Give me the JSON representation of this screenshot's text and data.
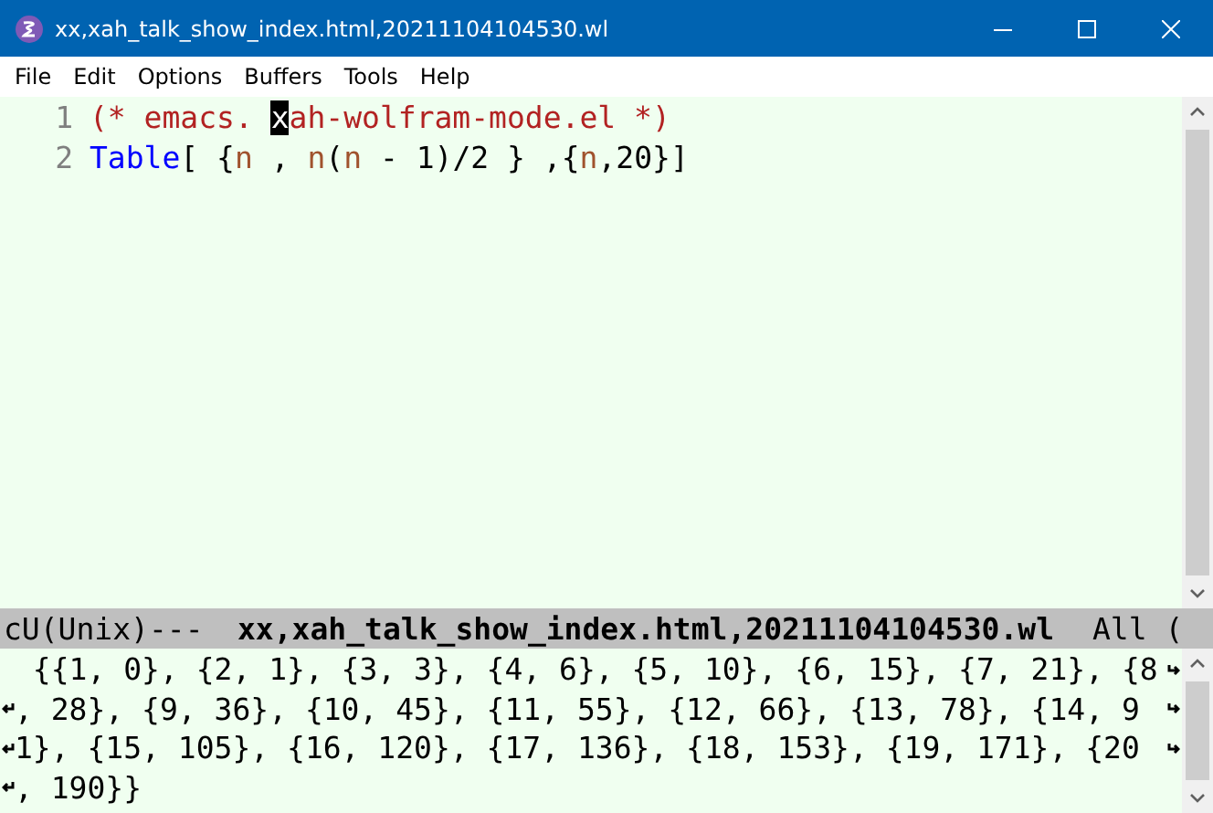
{
  "window": {
    "title": "xx,xah_talk_show_index.html,20211104104530.wl"
  },
  "menu": [
    "File",
    "Edit",
    "Options",
    "Buffers",
    "Tools",
    "Help"
  ],
  "editor": {
    "lines": [
      {
        "number": "1",
        "segments": [
          {
            "kind": "comment",
            "text": "(* emacs. "
          },
          {
            "kind": "cursor",
            "text": "x"
          },
          {
            "kind": "comment",
            "text": "ah-wolfram-mode.el *)"
          }
        ]
      },
      {
        "number": "2",
        "segments": [
          {
            "kind": "builtin",
            "text": "Table"
          },
          {
            "kind": "plain",
            "text": "[ {"
          },
          {
            "kind": "variable",
            "text": "n"
          },
          {
            "kind": "plain",
            "text": " , "
          },
          {
            "kind": "variable",
            "text": "n"
          },
          {
            "kind": "plain",
            "text": "("
          },
          {
            "kind": "variable",
            "text": "n"
          },
          {
            "kind": "plain",
            "text": " - 1)/2 } ,{"
          },
          {
            "kind": "variable",
            "text": "n"
          },
          {
            "kind": "plain",
            "text": ",20}]"
          }
        ]
      }
    ]
  },
  "mode_line": {
    "status": "cU(Unix)---",
    "buffer_name": "xx,xah_talk_show_index.html,20211104104530.wl",
    "position": "All ("
  },
  "output": {
    "lines": [
      " {{1, 0}, {2, 1}, {3, 3}, {4, 6}, {5, 10}, {6, 15}, {7, 21}, {8",
      ", 28}, {9, 36}, {10, 45}, {11, 55}, {12, 66}, {13, 78}, {14, 9",
      "1}, {15, 105}, {16, 120}, {17, 136}, {18, 153}, {19, 171}, {20",
      ", 190}}"
    ]
  }
}
